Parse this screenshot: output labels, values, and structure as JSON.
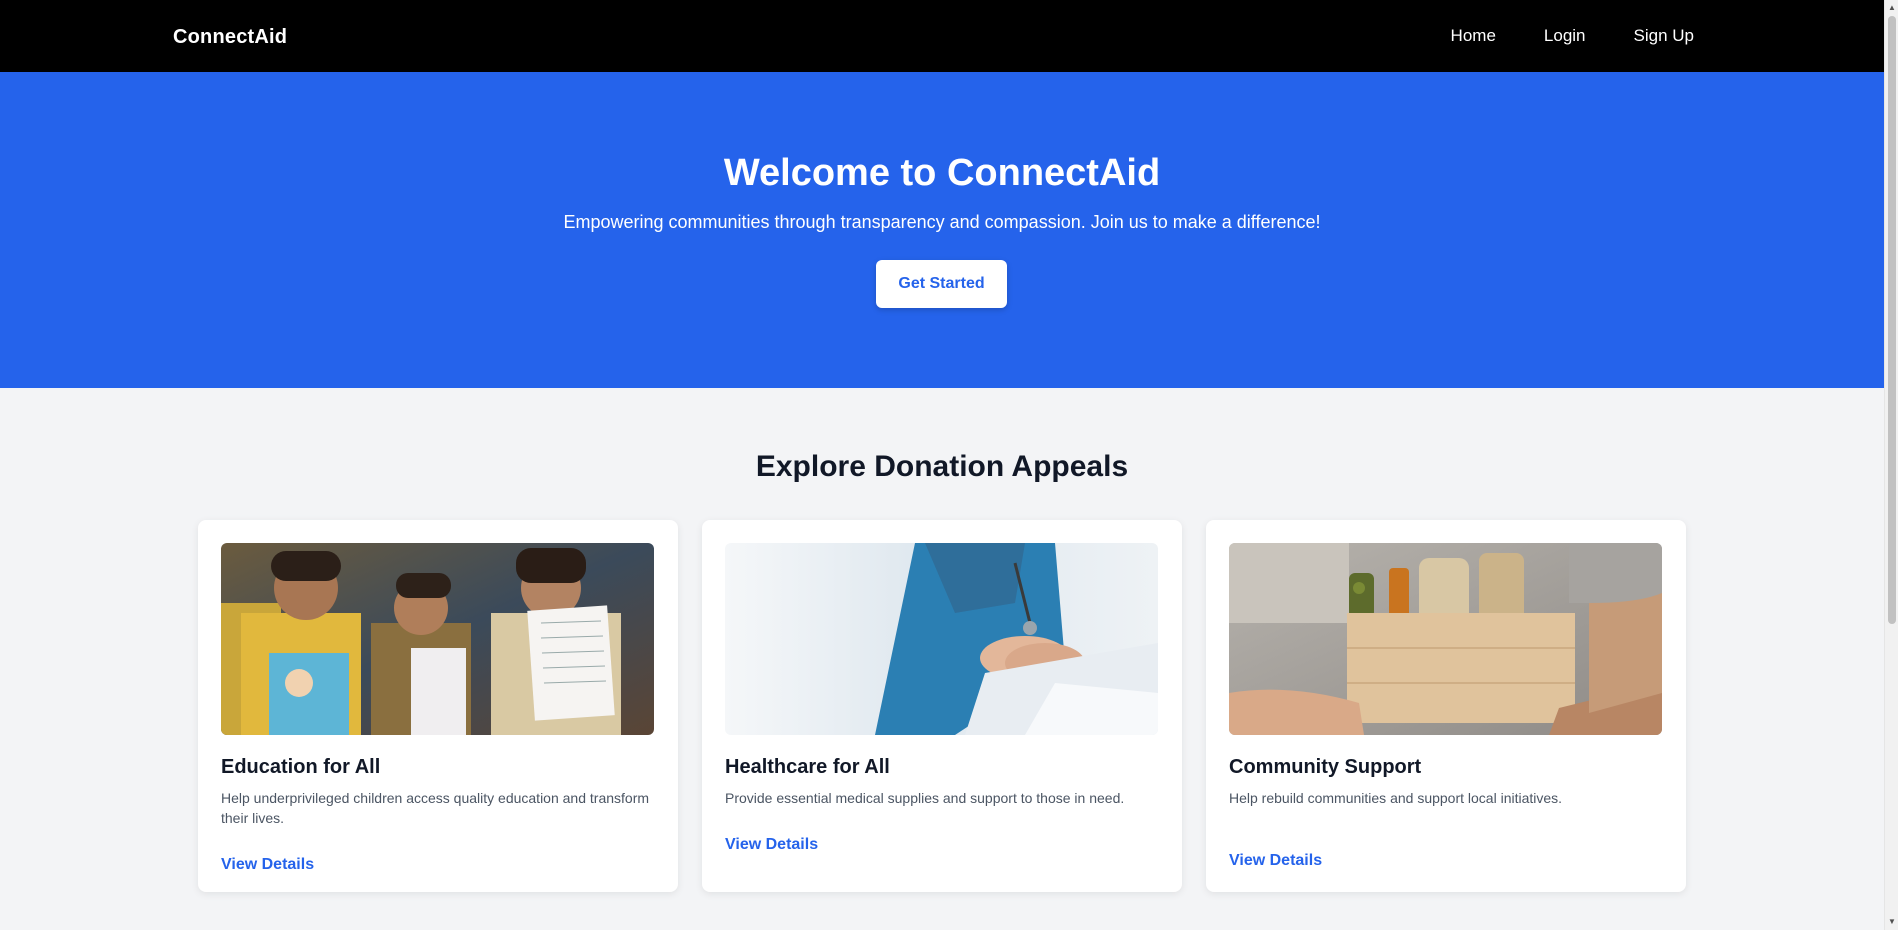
{
  "nav": {
    "brand": "ConnectAid",
    "links": [
      "Home",
      "Login",
      "Sign Up"
    ]
  },
  "hero": {
    "title": "Welcome to ConnectAid",
    "subtitle": "Empowering communities through transparency and compassion. Join us to make a difference!",
    "cta": "Get Started"
  },
  "appeals": {
    "title": "Explore Donation Appeals",
    "cards": [
      {
        "title": "Education for All",
        "description": "Help underprivileged children access quality education and transform their lives.",
        "link": "View Details",
        "image": "children-holding-books-photo"
      },
      {
        "title": "Healthcare for All",
        "description": "Provide essential medical supplies and support to those in need.",
        "link": "View Details",
        "image": "doctor-holding-patient-hands-photo"
      },
      {
        "title": "Community Support",
        "description": "Help rebuild communities and support local initiatives.",
        "link": "View Details",
        "image": "hands-passing-food-box-photo"
      }
    ]
  },
  "colors": {
    "primary": "#2563eb",
    "navbar": "#000000",
    "background": "#f3f4f6"
  }
}
